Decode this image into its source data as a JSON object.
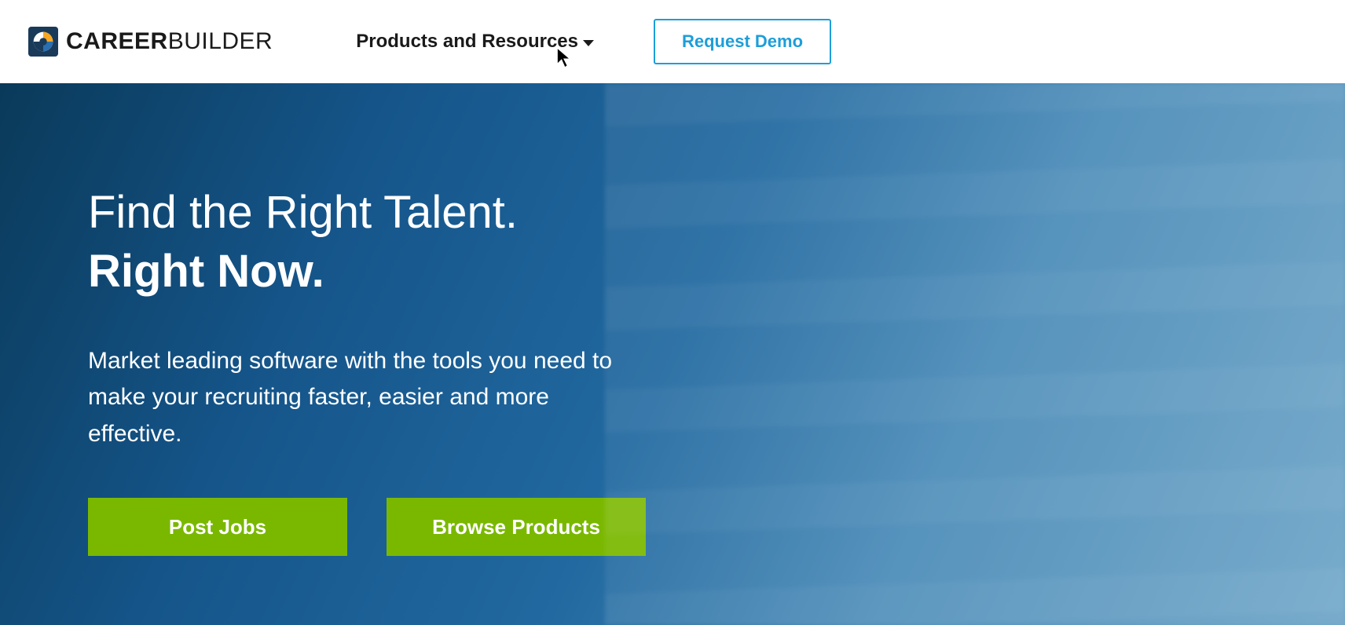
{
  "header": {
    "logo_bold": "CAREER",
    "logo_light": "BUILDER",
    "nav_products": "Products and Resources",
    "request_demo": "Request Demo"
  },
  "hero": {
    "headline_top": "Find the Right Talent.",
    "headline_bottom": "Right Now.",
    "subhead": "Market leading software with the tools you need to make your recruiting faster, easier and more effective.",
    "cta_post": "Post Jobs",
    "cta_browse": "Browse Products"
  }
}
